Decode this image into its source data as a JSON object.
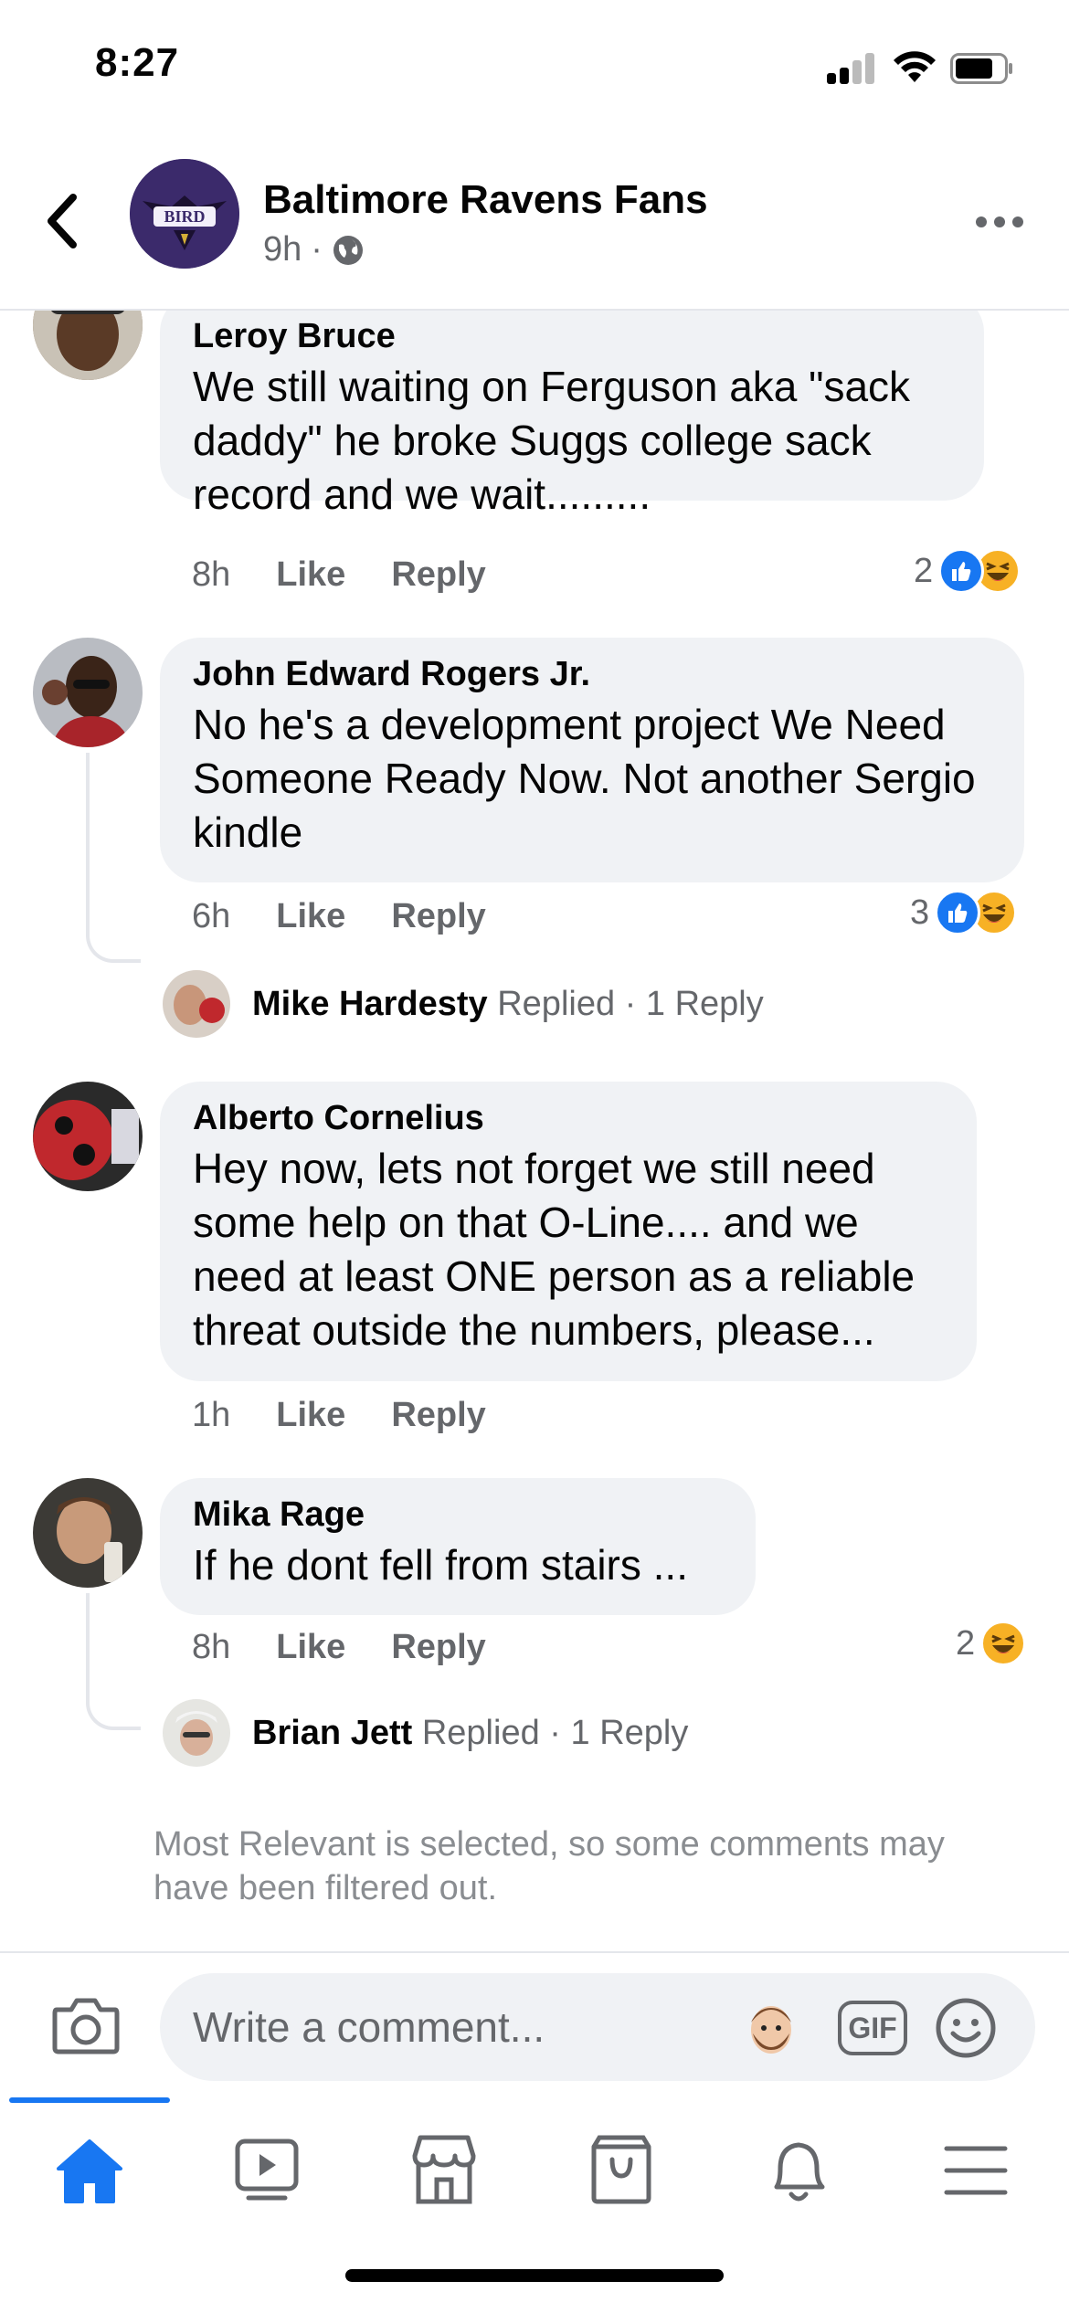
{
  "status_bar": {
    "time": "8:27"
  },
  "header": {
    "group_name": "Baltimore Ravens Fans",
    "post_age": "9h",
    "separator": "·",
    "avatar_text": "BIRD"
  },
  "comments": [
    {
      "author": "Leroy Bruce",
      "text": "We still waiting on Ferguson aka \"sack daddy\" he broke Suggs college sack record and we wait.........",
      "time": "8h",
      "like_label": "Like",
      "reply_label": "Reply",
      "reaction_count": "2",
      "reactions": [
        "like",
        "haha"
      ]
    },
    {
      "author": "John Edward Rogers Jr.",
      "text": "No he's a development project We Need Someone Ready Now. Not another Sergio kindle",
      "time": "6h",
      "like_label": "Like",
      "reply_label": "Reply",
      "reaction_count": "3",
      "reactions": [
        "like",
        "haha"
      ],
      "reply_preview": {
        "name": "Mike Hardesty",
        "action": "Replied",
        "separator": "·",
        "count": "1 Reply"
      }
    },
    {
      "author": "Alberto Cornelius",
      "text": "Hey now, lets not forget we still need some help on that O-Line.... and we need at least ONE person as a reliable threat outside the numbers, please...",
      "time": "1h",
      "like_label": "Like",
      "reply_label": "Reply"
    },
    {
      "author": "Mika Rage",
      "text": "If he dont fell from stairs ...",
      "time": "8h",
      "like_label": "Like",
      "reply_label": "Reply",
      "reaction_count": "2",
      "reactions": [
        "haha"
      ],
      "reply_preview": {
        "name": "Brian Jett",
        "action": "Replied",
        "separator": "·",
        "count": "1 Reply"
      }
    }
  ],
  "filter_note": "Most Relevant is selected, so some comments may have been filtered out.",
  "composer": {
    "placeholder": "Write a comment...",
    "gif_label": "GIF"
  },
  "tabs": [
    "home-icon",
    "watch-icon",
    "marketplace-icon",
    "shop-icon",
    "notifications-icon",
    "menu-icon"
  ],
  "colors": {
    "accent": "#1877f2",
    "bubble": "#f0f2f5",
    "secondary_text": "#65676b",
    "haha": "#f7b125"
  }
}
